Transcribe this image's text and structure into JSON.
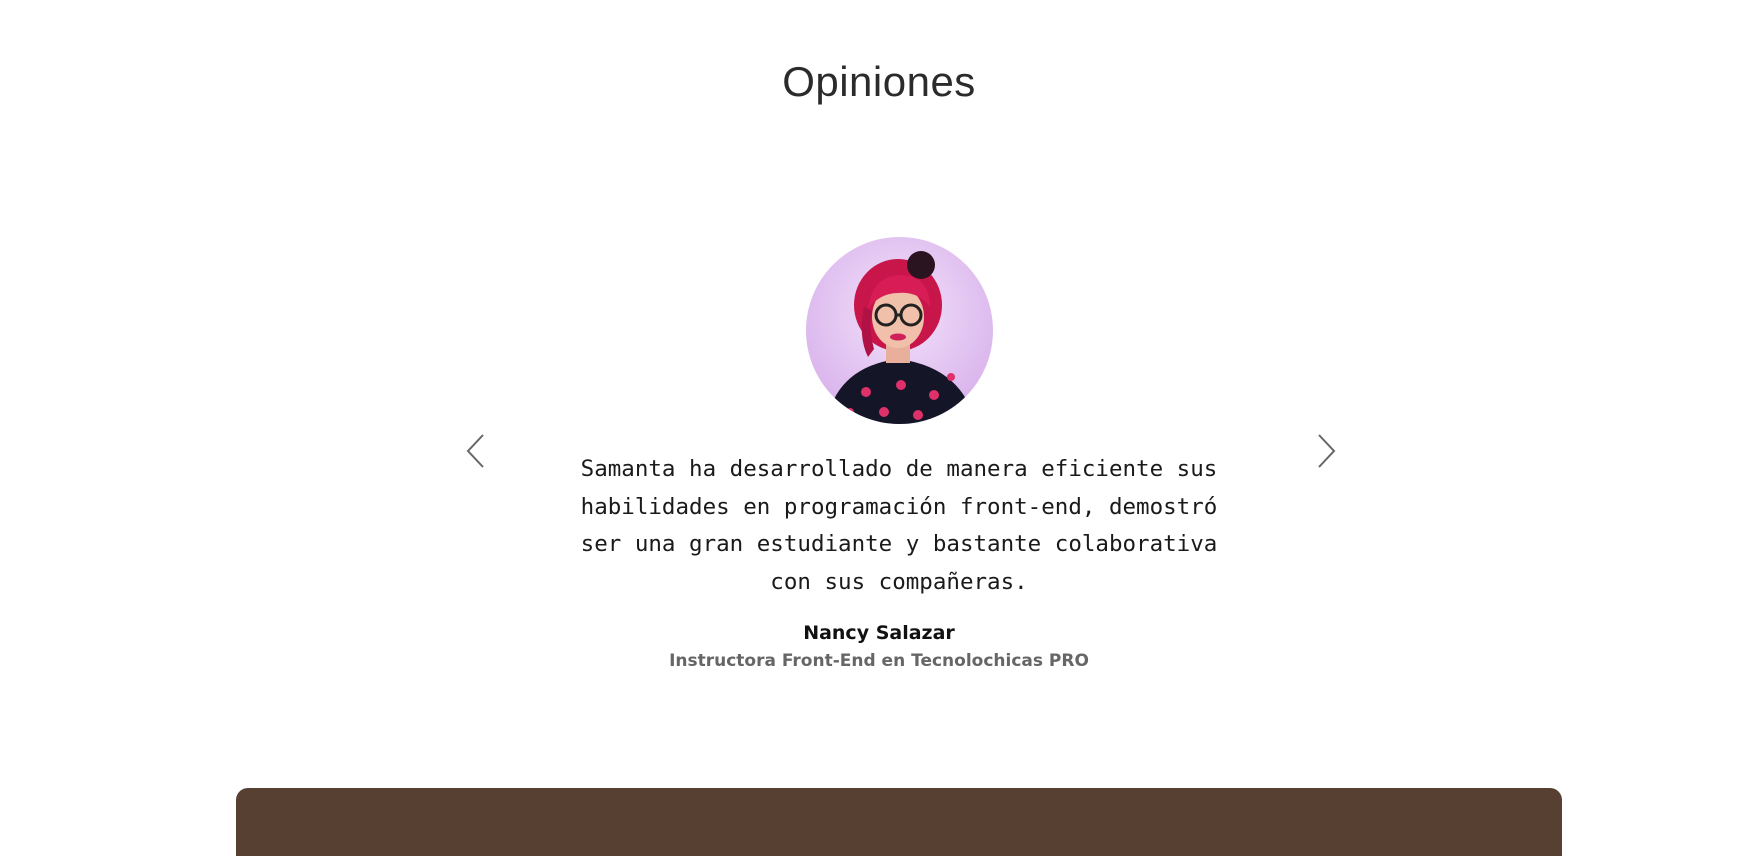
{
  "section": {
    "title": "Opiniones"
  },
  "testimonial": {
    "quote": "Samanta ha desarrollado de manera eficiente sus habilidades en programación front-end, demostró ser una gran estudiante y bastante colaborativa con sus compañeras.",
    "author_name": "Nancy Salazar",
    "author_role": "Instructora Front-End en Tecnolochicas PRO",
    "avatar": "portrait-photo"
  },
  "carousel": {
    "prev_icon": "chevron-left-icon",
    "next_icon": "chevron-right-icon"
  },
  "colors": {
    "footer_card": "#573f31",
    "avatar_background": "#e6c6f2",
    "arrow": "#666666"
  }
}
